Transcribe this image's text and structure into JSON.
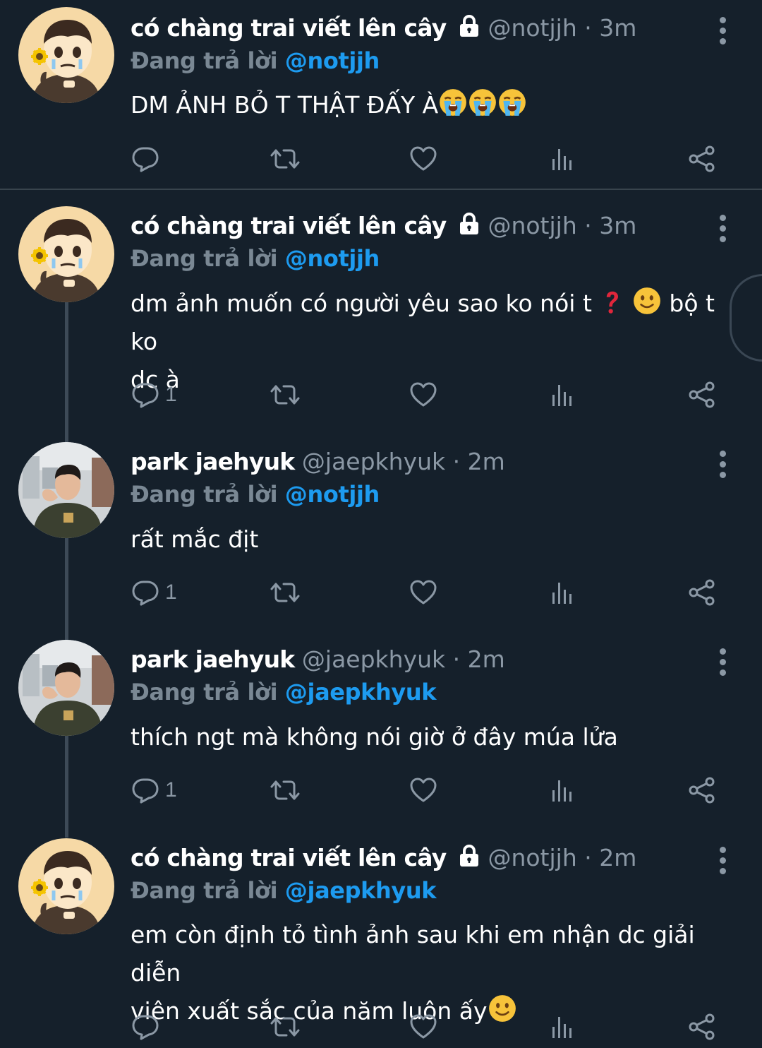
{
  "tweets": [
    {
      "name": "có chàng trai viết lên cây",
      "handle": "@notjjh",
      "time": "3m",
      "reply_prefix": "Đang trả lời",
      "reply_to": "@notjjh",
      "text": "DM ẢNH BỎ T THẬT ĐẤY À",
      "emoji": [
        "loudly-crying-face",
        "loudly-crying-face",
        "loudly-crying-face"
      ],
      "reply_count": ""
    },
    {
      "name": "có chàng trai viết lên cây",
      "handle": "@notjjh",
      "time": "3m",
      "reply_prefix": "Đang trả lời",
      "reply_to": "@notjjh",
      "text_a": "dm ảnh muốn có người yêu sao ko nói t",
      "text_b": "bộ t ko",
      "text_c": "dc à",
      "reply_count": "1"
    },
    {
      "name": "park jaehyuk",
      "handle": "@jaepkhyuk",
      "time": "2m",
      "reply_prefix": "Đang trả lời",
      "reply_to": "@notjjh",
      "text": "rất mắc địt",
      "reply_count": "1"
    },
    {
      "name": "park jaehyuk",
      "handle": "@jaepkhyuk",
      "time": "2m",
      "reply_prefix": "Đang trả lời",
      "reply_to": "@jaepkhyuk",
      "text": "thích ngt mà không nói giờ ở đây múa lửa",
      "reply_count": "1"
    },
    {
      "name": "có chàng trai viết lên cây",
      "handle": "@notjjh",
      "time": "2m",
      "reply_prefix": "Đang trả lời",
      "reply_to": "@jaepkhyuk",
      "text_a": "em còn định tỏ tình ảnh sau khi em nhận dc giải diễn",
      "text_b": "viên xuất sắc của năm luôn ấy",
      "reply_count": ""
    }
  ],
  "colors": {
    "background": "#15202b",
    "mention": "#1d9bf0",
    "secondary_text": "#8b98a5",
    "divider": "#38444d"
  },
  "icons": [
    "reply-icon",
    "retweet-icon",
    "like-icon",
    "views-icon",
    "share-icon",
    "more-icon",
    "lock-icon"
  ]
}
